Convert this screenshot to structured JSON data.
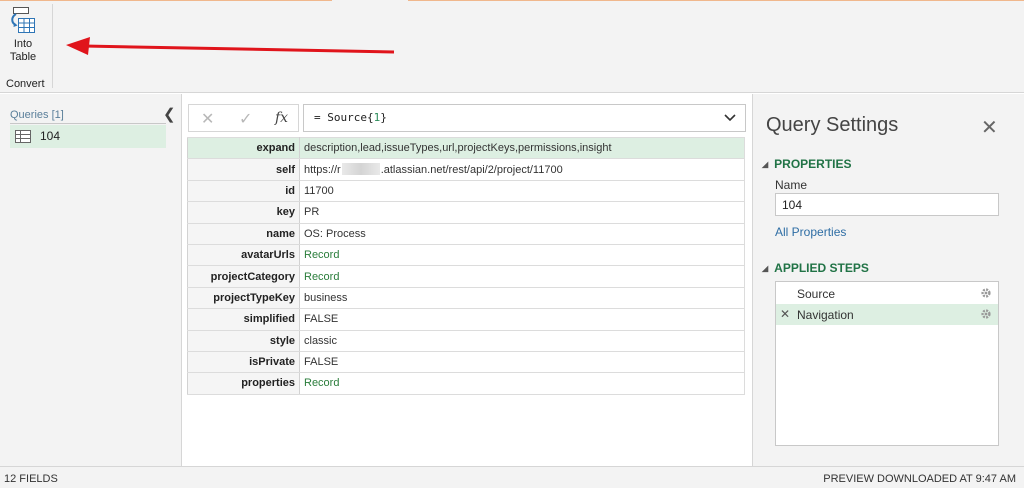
{
  "ribbon": {
    "into_table_label_line1": "Into",
    "into_table_label_line2": "Table",
    "group_label": "Convert"
  },
  "queries": {
    "header": "Queries [1]",
    "items": [
      {
        "name": "104"
      }
    ]
  },
  "formula_bar": {
    "prefix": "= ",
    "source": "Source",
    "index_open": "{",
    "index": "1",
    "index_close": "}",
    "fx_label": "fx"
  },
  "record": {
    "rows": [
      {
        "field": "expand",
        "value": "description,lead,issueTypes,url,projectKeys,permissions,insight",
        "selected": true
      },
      {
        "field": "self",
        "value_prefix": "https://r",
        "value_suffix": ".atlassian.net/rest/api/2/project/11700"
      },
      {
        "field": "id",
        "value": "11700"
      },
      {
        "field": "key",
        "value": "PR"
      },
      {
        "field": "name",
        "value": "OS: Process"
      },
      {
        "field": "avatarUrls",
        "value": "Record",
        "link": true
      },
      {
        "field": "projectCategory",
        "value": "Record",
        "link": true
      },
      {
        "field": "projectTypeKey",
        "value": "business"
      },
      {
        "field": "simplified",
        "value": "FALSE"
      },
      {
        "field": "style",
        "value": "classic"
      },
      {
        "field": "isPrivate",
        "value": "FALSE"
      },
      {
        "field": "properties",
        "value": "Record",
        "link": true
      }
    ]
  },
  "settings": {
    "title": "Query Settings",
    "properties_heading": "PROPERTIES",
    "name_label": "Name",
    "name_value": "104",
    "all_properties_link": "All Properties",
    "applied_steps_heading": "APPLIED STEPS",
    "steps": [
      {
        "name": "Source"
      },
      {
        "name": "Navigation",
        "active": true
      }
    ]
  },
  "status": {
    "left": "12 FIELDS",
    "right": "PREVIEW DOWNLOADED AT 9:47 AM"
  },
  "colors": {
    "selection": "#ddefe2",
    "accent_green": "#217346",
    "annotation_arrow": "#e0141b"
  },
  "icons": {
    "into_table": "into-table-icon",
    "table": "table-icon",
    "cancel": "cancel-icon",
    "commit": "checkmark-icon",
    "close": "close-icon",
    "gear": "gear-icon",
    "chevron": "chevron-down-icon",
    "collapse": "chevron-left-icon"
  }
}
